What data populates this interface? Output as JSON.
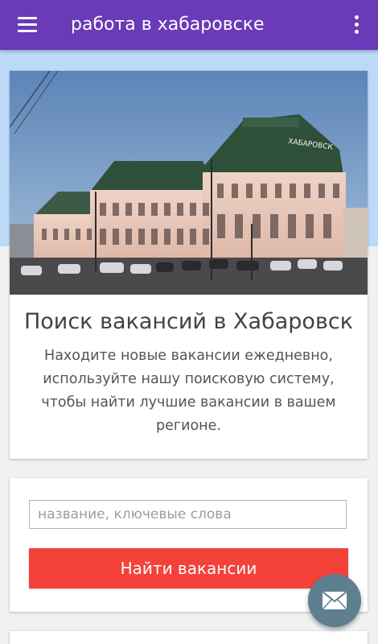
{
  "appbar": {
    "title": "работа в хабаровске",
    "menu_icon": "hamburger-menu-icon",
    "overflow_icon": "more-vert-icon",
    "color": "#6a3ab8"
  },
  "hero": {
    "photo_sign": "ХАБАРОВСК",
    "title": "Поиск вакансий в Хабаровск",
    "description": "Находите новые вакансии ежедневно, используйте нашу поисковую систему, чтобы найти лучшие вакансии в вашем регионе."
  },
  "search": {
    "input_value": "",
    "input_placeholder": "название, ключевые слова",
    "button_label": "Найти вакансии",
    "button_color": "#f4413a"
  },
  "fab": {
    "icon": "mail-envelope-icon",
    "color": "#5f7f8f"
  },
  "colors": {
    "top_band": "#bcdaf7",
    "page_background": "#f1f1f1"
  }
}
